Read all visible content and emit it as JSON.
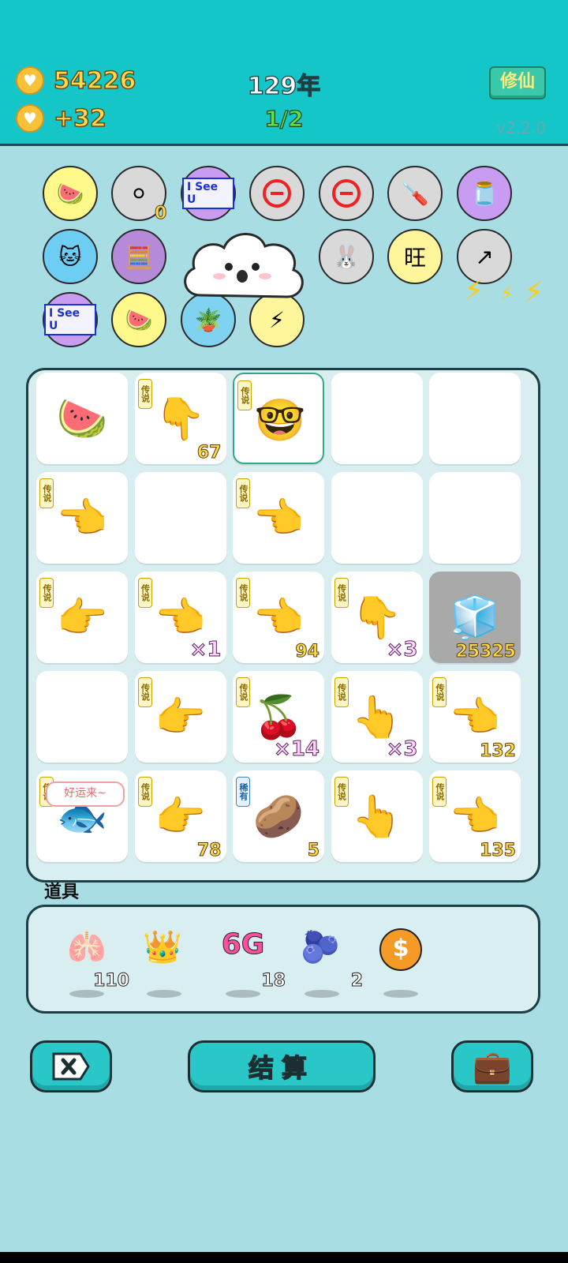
{
  "header": {
    "coins": "54226",
    "income": "+32",
    "year": "129年",
    "ratio": "1/2",
    "cultivate_button": "修仙",
    "version": "v2.2.0"
  },
  "badges_row_note_count": "0",
  "board": {
    "tiles": [
      {
        "tag": "",
        "num": ""
      },
      {
        "tag": "传说",
        "num": "67"
      },
      {
        "tag": "传说",
        "num": ""
      },
      {
        "tag": "",
        "num": ""
      },
      {
        "tag": "",
        "num": ""
      },
      {
        "tag": "传说",
        "num": ""
      },
      {
        "tag": "",
        "num": ""
      },
      {
        "tag": "传说",
        "num": ""
      },
      {
        "tag": "",
        "num": ""
      },
      {
        "tag": "",
        "num": ""
      },
      {
        "tag": "传说",
        "num": ""
      },
      {
        "tag": "传说",
        "num": "×1"
      },
      {
        "tag": "传说",
        "num": "94"
      },
      {
        "tag": "传说",
        "num": "×3"
      },
      {
        "tag": "",
        "num": "25325"
      },
      {
        "tag": "",
        "num": ""
      },
      {
        "tag": "传说",
        "num": ""
      },
      {
        "tag": "传说",
        "num": "×14"
      },
      {
        "tag": "传说",
        "num": "×3"
      },
      {
        "tag": "传说",
        "num": "132"
      },
      {
        "tag": "传说",
        "num": ""
      },
      {
        "tag": "传说",
        "num": "78"
      },
      {
        "tag": "稀有",
        "num": "5"
      },
      {
        "tag": "传说",
        "num": ""
      },
      {
        "tag": "传说",
        "num": "135"
      }
    ],
    "speech": "好运来~"
  },
  "tools": {
    "label": "道具",
    "counts": [
      "110",
      "",
      "18",
      "2",
      ""
    ],
    "sixg_text": "6G"
  },
  "buttons": {
    "settle": "结算"
  },
  "badge_text": {
    "isee": "I See U"
  }
}
